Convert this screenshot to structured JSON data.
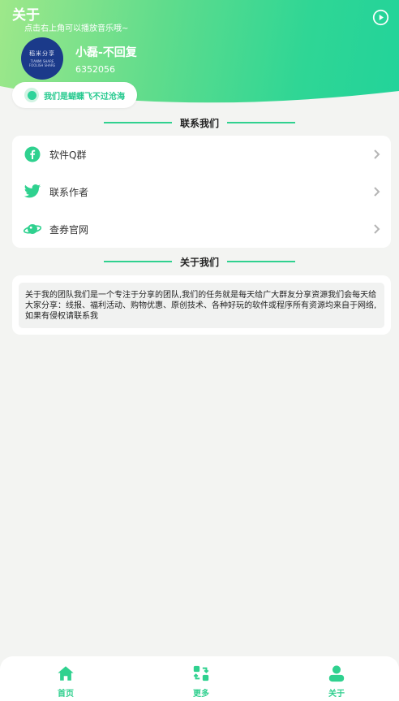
{
  "header": {
    "title": "关于",
    "subtitle": "点击右上角可以播放音乐哦~",
    "play_icon": "play-circle-icon"
  },
  "profile": {
    "avatar_text": "稻米分享",
    "avatar_sub1": "TIANMI SHARE",
    "avatar_sub2": "FOOLISH SHARE",
    "name": "小磊-不回复",
    "id": "6352056",
    "motto": "我们是蝴蝶飞不过沧海"
  },
  "contact": {
    "heading": "联系我们",
    "items": [
      {
        "label": "软件Q群",
        "icon": "facebook-icon"
      },
      {
        "label": "联系作者",
        "icon": "twitter-bird-icon"
      },
      {
        "label": "查券官网",
        "icon": "planet-icon"
      }
    ]
  },
  "about": {
    "heading": "关于我们",
    "text": "关于我的团队我们是一个专注于分享的团队,我们的任务就是每天给广大群友分享资源我们会每天给大家分享：线报、福利活动、购物优惠、原创技术、各种好玩的软件或程序所有资源均来自于网络,如果有侵权请联系我"
  },
  "tabbar": {
    "tabs": [
      {
        "label": "首页",
        "icon": "home-icon"
      },
      {
        "label": "更多",
        "icon": "swap-icon"
      },
      {
        "label": "关于",
        "icon": "user-icon"
      }
    ]
  },
  "colors": {
    "accent": "#2fd18f",
    "background": "#f3f4f2"
  }
}
